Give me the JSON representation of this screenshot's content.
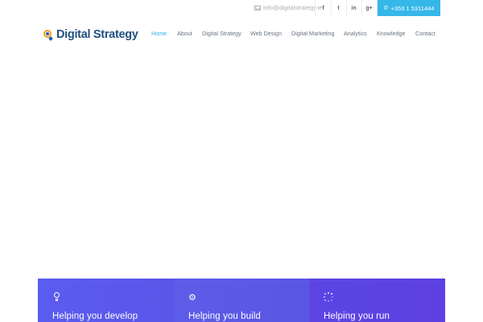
{
  "topbar": {
    "email": "info@digitalstrategy.ie",
    "social": [
      {
        "icon": "facebook-icon",
        "glyph": "f"
      },
      {
        "icon": "twitter-icon",
        "glyph": "t"
      },
      {
        "icon": "linkedin-icon",
        "glyph": "in"
      },
      {
        "icon": "google-plus-icon",
        "glyph": "g+"
      }
    ],
    "phone": "+353 1 5311444"
  },
  "header": {
    "logo_text": "Digital Strategy",
    "nav": [
      {
        "label": "Home",
        "active": true
      },
      {
        "label": "About",
        "active": false
      },
      {
        "label": "Digital Strategy",
        "active": false
      },
      {
        "label": "Web Design",
        "active": false
      },
      {
        "label": "Digital Marketing",
        "active": false
      },
      {
        "label": "Analytics",
        "active": false
      },
      {
        "label": "Knowledge",
        "active": false
      },
      {
        "label": "Contact",
        "active": false
      }
    ]
  },
  "features": [
    {
      "icon": "lightbulb-icon",
      "title": "Helping you develop"
    },
    {
      "icon": "gear-icon",
      "title": "Helping you build"
    },
    {
      "icon": "spinner-icon",
      "title": "Helping you run"
    }
  ],
  "colors": {
    "accent": "#2fb1e2",
    "phone_button": "#35b7e8",
    "band": "#5b57e8"
  }
}
